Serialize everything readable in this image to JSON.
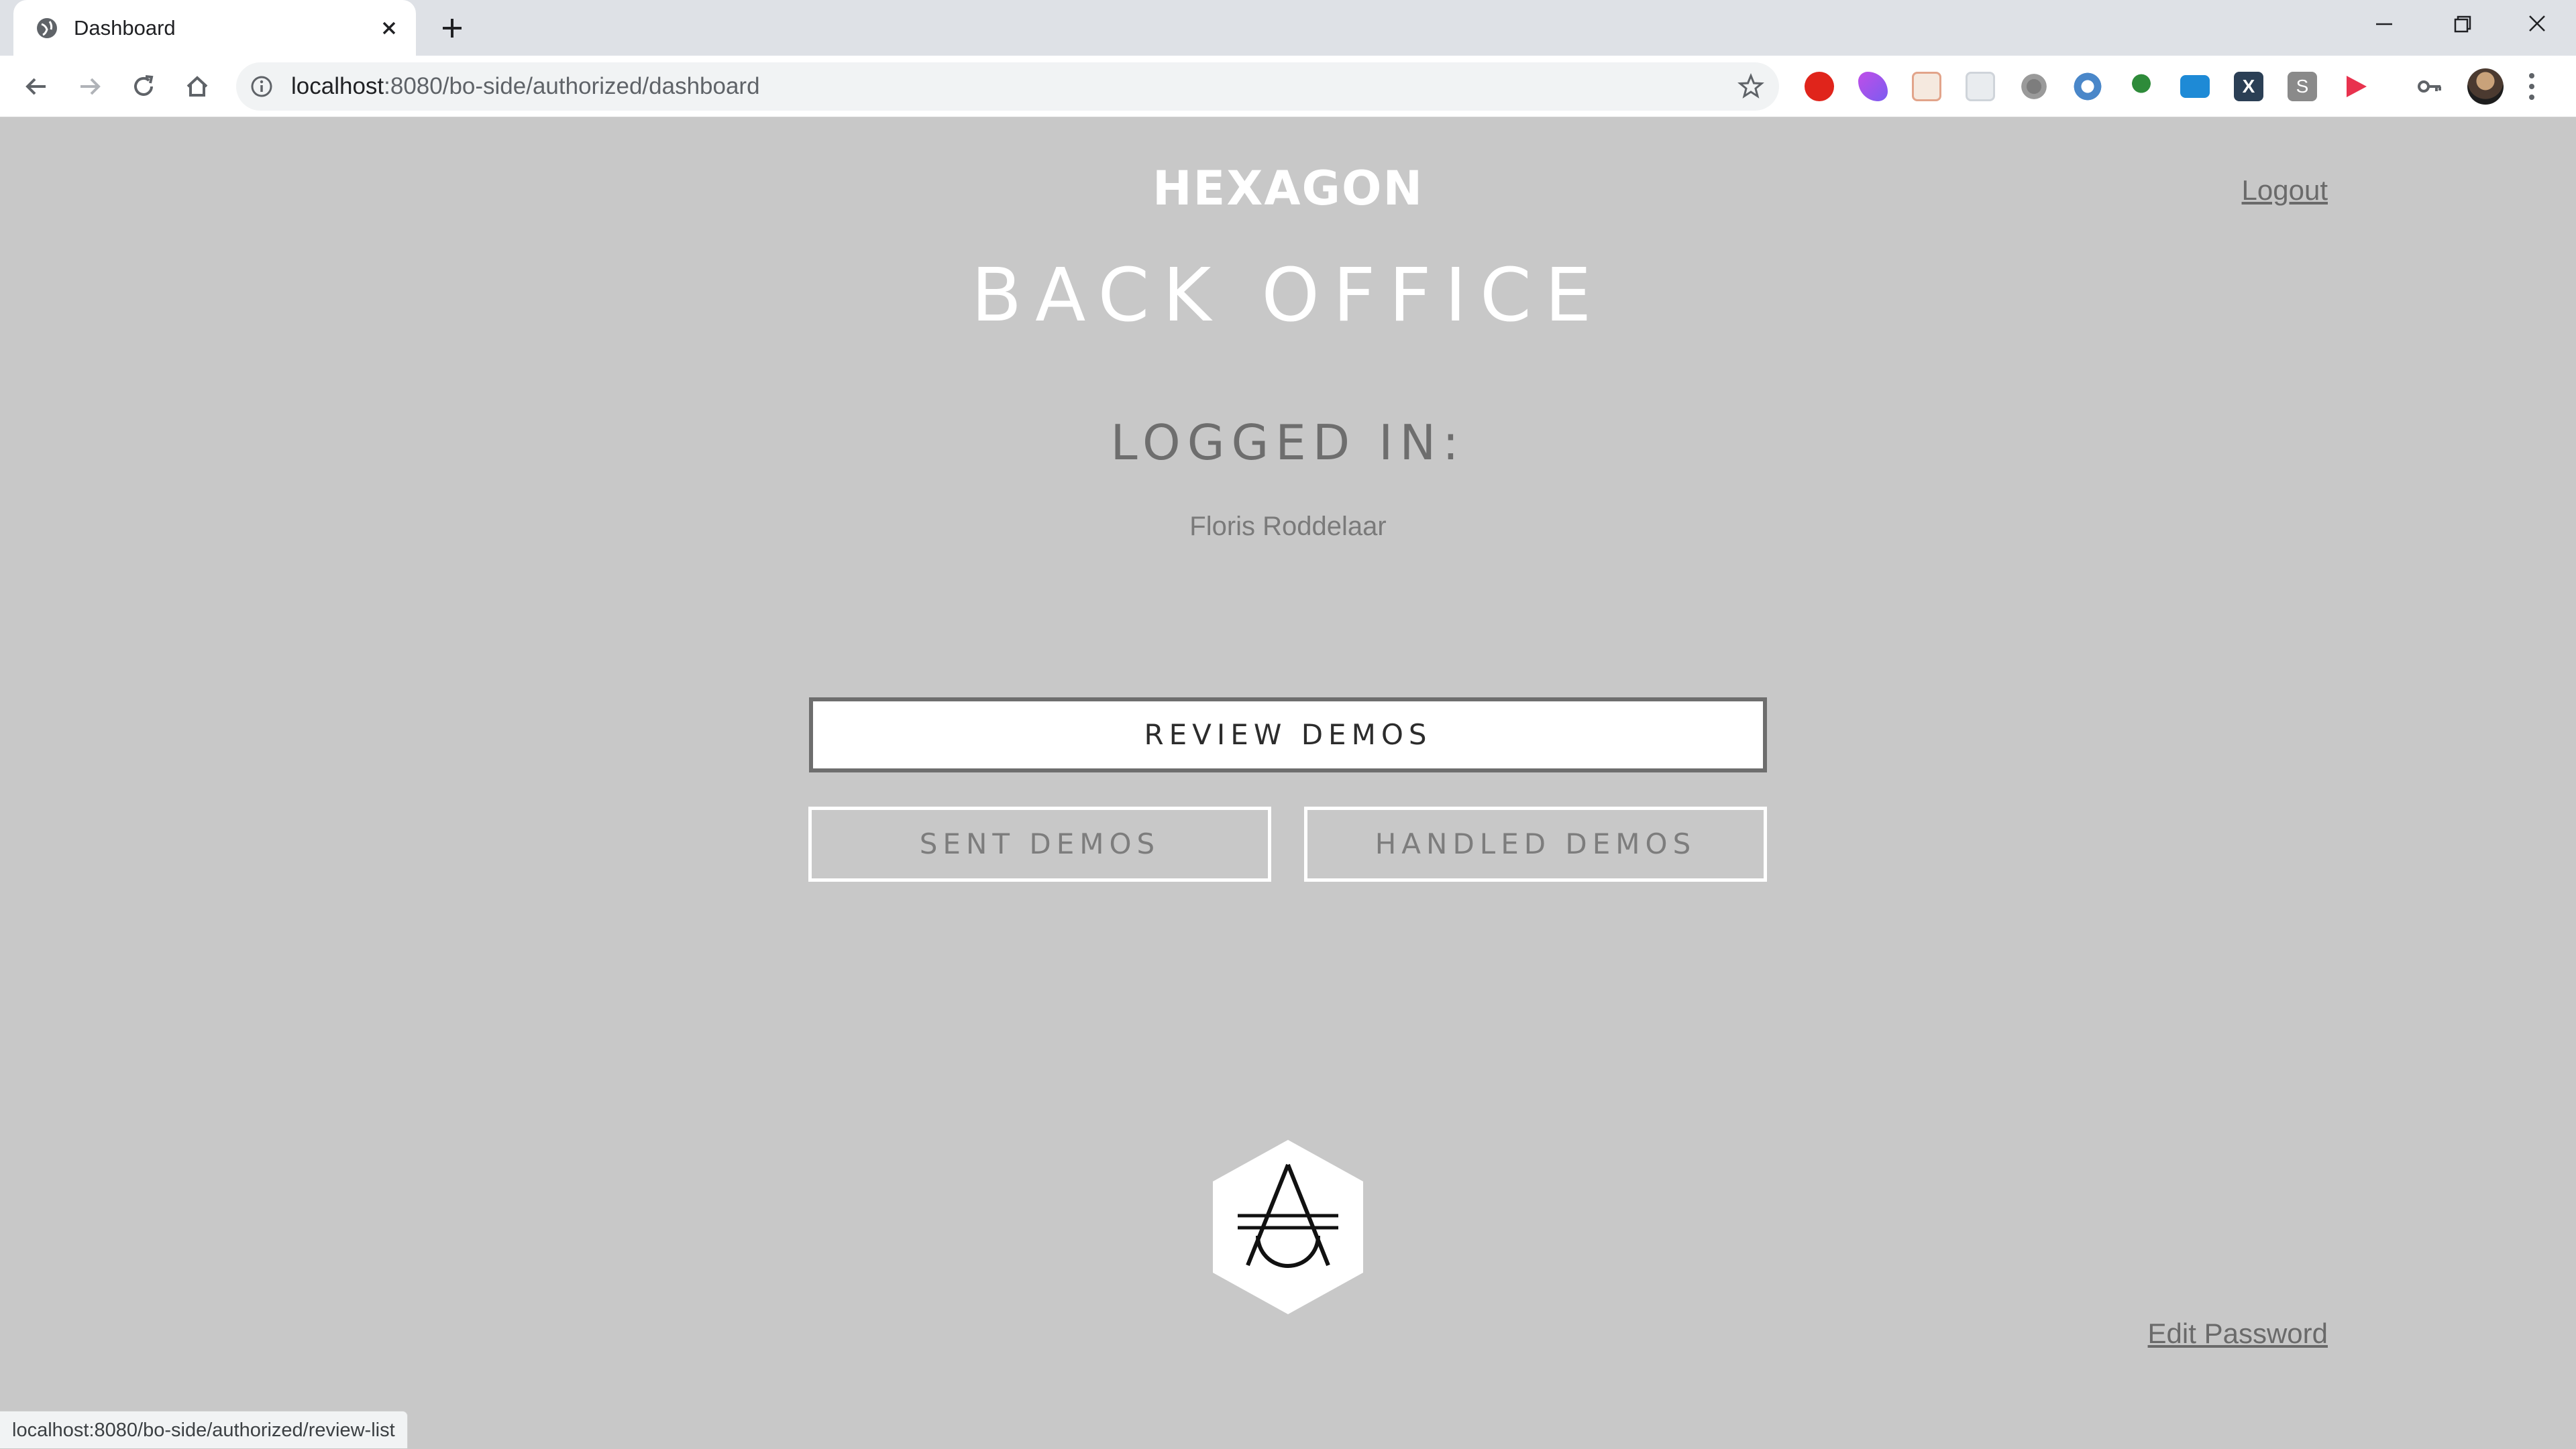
{
  "browser": {
    "tab_title": "Dashboard",
    "url_host": "localhost",
    "url_rest": ":8080/bo-side/authorized/dashboard",
    "extensions": [
      "adblock-icon",
      "drops-icon",
      "calendar-icon",
      "grid-icon",
      "settings-icon",
      "circle-ext-icon",
      "plant-icon",
      "monitor-icon",
      "x-ext-icon",
      "s-ext-icon",
      "play-ext-icon",
      "key-icon"
    ],
    "status_url": "localhost:8080/bo-side/authorized/review-list"
  },
  "header": {
    "logo_text": "HEXAGON",
    "logout_label": "Logout"
  },
  "main": {
    "title": "BACK OFFICE",
    "logged_in_label": "LOGGED IN:",
    "username": "Floris Roddelaar",
    "review_button": "REVIEW DEMOS",
    "sent_button": "SENT DEMOS",
    "handled_button": "HANDLED DEMOS"
  },
  "footer": {
    "edit_password_label": "Edit Password"
  },
  "colors": {
    "page_bg": "#c8c8c8",
    "accent_white": "#ffffff",
    "muted_text": "#6e6e6e"
  }
}
